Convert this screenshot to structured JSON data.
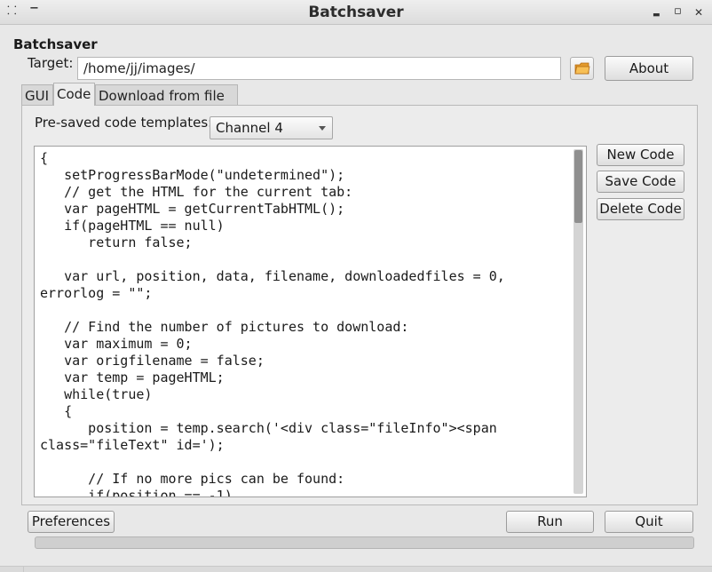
{
  "window": {
    "title": "Batchsaver",
    "menu_icon": "⸬",
    "pin_icon": "−",
    "minimize_icon": "▬",
    "maximize_icon": "▫",
    "close_icon": "✕"
  },
  "app": {
    "heading": "Batchsaver",
    "target_label": "Target:",
    "target_value": "/home/jj/images/",
    "folder_icon": "folder-open-icon",
    "about_label": "About"
  },
  "tabs": [
    {
      "label": "GUI"
    },
    {
      "label": "Code"
    },
    {
      "label": "Download from file"
    }
  ],
  "active_tab": "Code",
  "code_tab": {
    "templates_label": "Pre-saved code templates:",
    "template_selected": "Channel 4",
    "new_code_label": "New Code",
    "save_code_label": "Save Code",
    "delete_code_label": "Delete Code",
    "code_text": "{\n   setProgressBarMode(\"undetermined\");\n   // get the HTML for the current tab:\n   var pageHTML = getCurrentTabHTML();\n   if(pageHTML == null)\n      return false;\n\n   var url, position, data, filename, downloadedfiles = 0,\nerrorlog = \"\";\n\n   // Find the number of pictures to download:\n   var maximum = 0;\n   var origfilename = false;\n   var temp = pageHTML;\n   while(true)\n   {\n      position = temp.search('<div class=\"fileInfo\"><span\nclass=\"fileText\" id=');\n\n      // If no more pics can be found:\n      if(position == -1)"
  },
  "footer": {
    "preferences_label": "Preferences",
    "run_label": "Run",
    "quit_label": "Quit",
    "progress": 0
  },
  "colors": {
    "window_bg": "#e8e8e8",
    "editor_bg": "#ffffff",
    "folder_accent": "#f0a430"
  }
}
